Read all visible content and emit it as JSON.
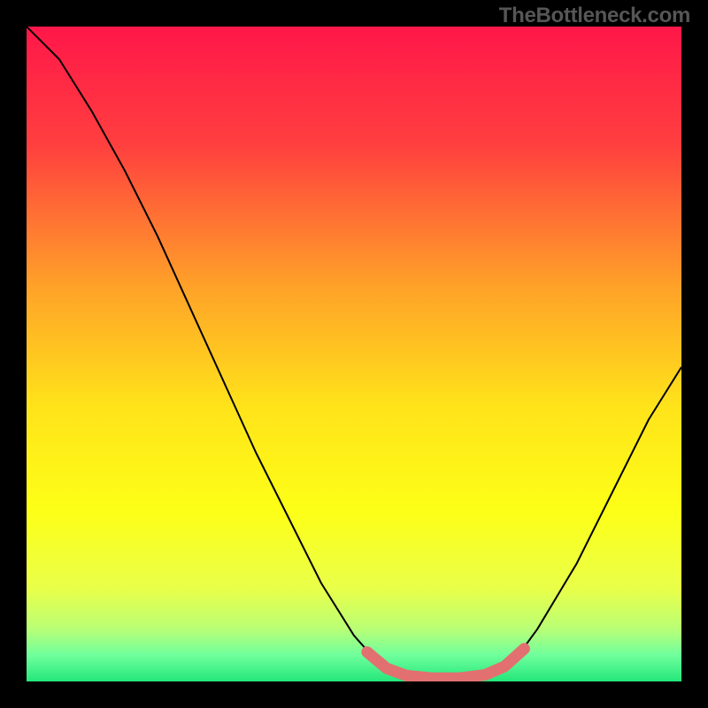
{
  "watermark": "TheBottleneck.com",
  "chart_data": {
    "type": "line",
    "title": "",
    "xlabel": "",
    "ylabel": "",
    "xlim": [
      0,
      100
    ],
    "ylim": [
      0,
      100
    ],
    "gradient_stops": [
      {
        "offset": 0,
        "color": "#ff1749"
      },
      {
        "offset": 18,
        "color": "#ff3f3f"
      },
      {
        "offset": 40,
        "color": "#ffa328"
      },
      {
        "offset": 58,
        "color": "#ffe31a"
      },
      {
        "offset": 74,
        "color": "#fdff17"
      },
      {
        "offset": 86,
        "color": "#e8ff4a"
      },
      {
        "offset": 92,
        "color": "#b9ff76"
      },
      {
        "offset": 96,
        "color": "#6fff9d"
      },
      {
        "offset": 100,
        "color": "#23e77a"
      }
    ],
    "series": [
      {
        "name": "bottleneck-curve",
        "stroke": "#000000",
        "stroke_width": 2,
        "points": [
          {
            "x": 0,
            "y": 100
          },
          {
            "x": 5,
            "y": 95
          },
          {
            "x": 10,
            "y": 87
          },
          {
            "x": 15,
            "y": 78
          },
          {
            "x": 20,
            "y": 68
          },
          {
            "x": 25,
            "y": 57
          },
          {
            "x": 30,
            "y": 46
          },
          {
            "x": 35,
            "y": 35
          },
          {
            "x": 40,
            "y": 25
          },
          {
            "x": 45,
            "y": 15
          },
          {
            "x": 50,
            "y": 7
          },
          {
            "x": 54,
            "y": 2.5
          },
          {
            "x": 58,
            "y": 0.5
          },
          {
            "x": 62,
            "y": 0
          },
          {
            "x": 66,
            "y": 0
          },
          {
            "x": 70,
            "y": 0.5
          },
          {
            "x": 74,
            "y": 2.5
          },
          {
            "x": 78,
            "y": 8
          },
          {
            "x": 84,
            "y": 18
          },
          {
            "x": 90,
            "y": 30
          },
          {
            "x": 95,
            "y": 40
          },
          {
            "x": 100,
            "y": 48
          }
        ]
      },
      {
        "name": "optimal-band",
        "stroke": "#e27070",
        "stroke_width": 13,
        "linecap": "round",
        "points": [
          {
            "x": 52,
            "y": 4.5
          },
          {
            "x": 55,
            "y": 2.0
          },
          {
            "x": 58,
            "y": 0.9
          },
          {
            "x": 62,
            "y": 0.5
          },
          {
            "x": 66,
            "y": 0.5
          },
          {
            "x": 70,
            "y": 1.0
          },
          {
            "x": 73,
            "y": 2.3
          },
          {
            "x": 76,
            "y": 5.0
          }
        ]
      }
    ]
  }
}
